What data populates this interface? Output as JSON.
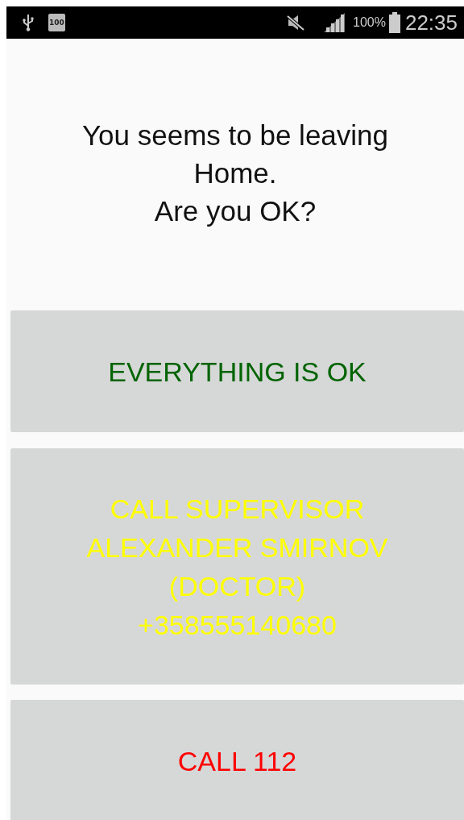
{
  "status_bar": {
    "battery_level_text": "100",
    "battery_percent": "100%",
    "time": "22:35"
  },
  "message": "You seems to be leaving\nHome.\nAre you OK?",
  "buttons": [
    {
      "label": "EVERYTHING IS OK",
      "color": "#006400"
    },
    {
      "label": "CALL SUPERVISOR\nALEXANDER SMIRNOV\n(DOCTOR)\n+358555140680",
      "color": "#ffff00"
    },
    {
      "label": "CALL 112",
      "color": "#ff0000"
    }
  ]
}
